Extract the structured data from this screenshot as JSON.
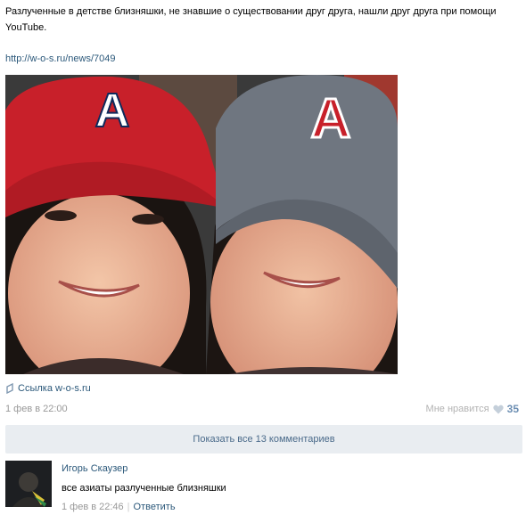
{
  "post": {
    "text": "Разлученные в детстве близняшки, не знавшие о существовании друг друга, нашли друг друга при помощи YouTube.",
    "link": "http://w-o-s.ru/news/7049",
    "photo": {
      "cap_letter_left": "A",
      "cap_letter_right": "A"
    },
    "attachment_label": "Ссылка w-o-s.ru",
    "date": "1 фев в 22:00",
    "like_label": "Мне нравится",
    "like_count": "35"
  },
  "show_comments_label": "Показать все 13 комментариев",
  "comment": {
    "author": "Игорь Скаузер",
    "text": "все азиаты разлученные близняшки",
    "date": "1 фев в 22:46",
    "separator": "|",
    "reply_label": "Ответить"
  },
  "colors": {
    "link": "#2b587a",
    "muted": "#999999",
    "like_count": "#6d8fb3",
    "comments_bar": "#e9edf1",
    "cap_red": "#c8202a",
    "cap_gray": "#6f7680"
  }
}
